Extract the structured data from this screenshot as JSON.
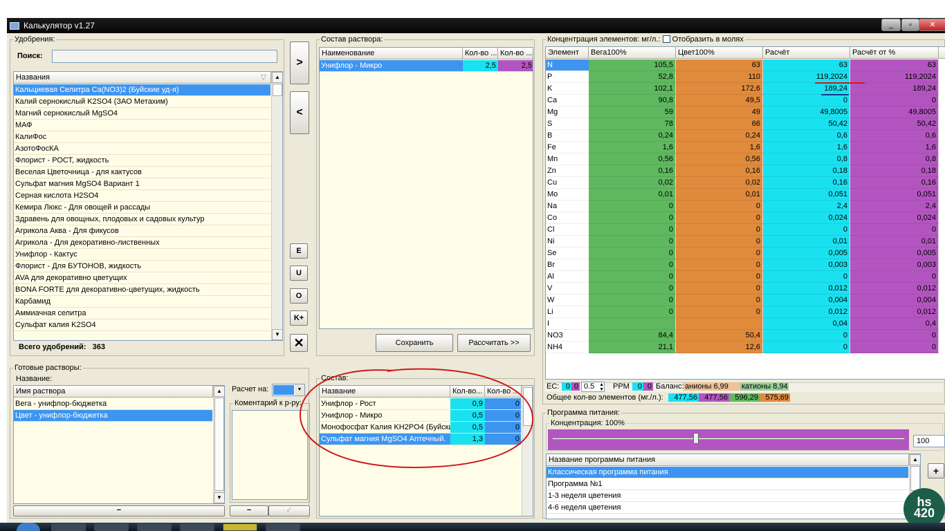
{
  "window": {
    "title": "Калькулятор v1.27"
  },
  "fertilizers": {
    "group_label": "Удобрения:",
    "search_label": "Поиск:",
    "search_value": "",
    "column_name": "Названия",
    "items": [
      "Кальциевая Селитра Ca(NO3)2 (Буйские уд-я)",
      "Калий  сернокислый  K2SO4 (ЗАО Метахим)",
      "Магний сернокислый MgSO4",
      "МАФ",
      "КалиФос",
      "АзотоФосКА",
      "Флорист - РОСТ, жидкость",
      "Веселая Цветочница - для кактусов",
      "Сульфат магния MgSO4 Вариант 1",
      "Серная кислота H2SO4",
      "Кемира Люкс - Для овощей и рассады",
      "Здравень для овощных, плодовых и садовых культур",
      "Агрикола Аква - Для фикусов",
      "Агрикола - Для декоративно-лиственных",
      "Унифлор - Кактус",
      "Флорист - Для БУТОНОВ, жидкость",
      "AVA для декоративно цветущих",
      "BONA FORTE для декоративно-цветущих, жидкость",
      "Карбамид",
      "Аммиачная селитра",
      "Сульфат калия K2SO4"
    ],
    "total_label": "Всего удобрений:",
    "total_value": "363"
  },
  "side_buttons": {
    "add": ">",
    "remove": "<",
    "e": "E",
    "u": "U",
    "o": "O",
    "kplus": "K+",
    "delete": "✕"
  },
  "solution": {
    "group_label": "Состав раствора:",
    "col_name": "Наименование",
    "col_qty1": "Кол-во ...",
    "col_qty2": "Кол-во ...",
    "rows": [
      {
        "name": "Унифлор - Микро",
        "q1": "2,5",
        "q2": "2,5"
      }
    ],
    "save_label": "Сохранить",
    "calc_label": "Рассчитать >>"
  },
  "ready": {
    "group_label": "Готовые растворы:",
    "name_label": "Название:",
    "col_name": "Имя раствора",
    "rows": [
      "Вега - унифлор-бюджетка",
      "Цвет - унифлор-бюджетка"
    ],
    "minus": "−",
    "calc_for_label": "Расчет на:",
    "comment_label": "Коментарий к р-ру:",
    "comment_minus": "−",
    "comment_check": "✓"
  },
  "composition": {
    "group_label": "Состав:",
    "col_name": "Название",
    "col_q1": "Кол-во...",
    "col_q2": "Кол-во ...",
    "rows": [
      {
        "name": "Унифлор - Рост",
        "q1": "0,9",
        "q2": "0"
      },
      {
        "name": "Унифлор - Микро",
        "q1": "0,5",
        "q2": "0"
      },
      {
        "name": "Монофосфат Калия KH2PO4 (Буйски",
        "q1": "0,5",
        "q2": "0"
      },
      {
        "name": "Сульфат магния MgSO4 Аптечный.",
        "q1": "1,3",
        "q2": "0"
      }
    ]
  },
  "concentration": {
    "group_label": "Концентрация элементов: мг/л.:",
    "moles_label": "Отобразить в молях",
    "headers": [
      "Элемент",
      "Вега100%",
      "Цвет100%",
      "Расчёт",
      "Расчёт от %"
    ],
    "rows": [
      [
        "N",
        "105,5",
        "63",
        "63",
        "63"
      ],
      [
        "P",
        "52,8",
        "110",
        "119,2024",
        "119,2024"
      ],
      [
        "K",
        "102,1",
        "172,6",
        "189,24",
        "189,24"
      ],
      [
        "Ca",
        "90,8",
        "49,5",
        "0",
        "0"
      ],
      [
        "Mg",
        "59",
        "49",
        "49,8005",
        "49,8005"
      ],
      [
        "S",
        "78",
        "66",
        "50,42",
        "50,42"
      ],
      [
        "B",
        "0,24",
        "0,24",
        "0,6",
        "0,6"
      ],
      [
        "Fe",
        "1,6",
        "1,6",
        "1,6",
        "1,6"
      ],
      [
        "Mn",
        "0,56",
        "0,56",
        "0,8",
        "0,8"
      ],
      [
        "Zn",
        "0,16",
        "0,16",
        "0,18",
        "0,18"
      ],
      [
        "Cu",
        "0,02",
        "0,02",
        "0,16",
        "0,16"
      ],
      [
        "Mo",
        "0,01",
        "0,01",
        "0,051",
        "0,051"
      ],
      [
        "Na",
        "0",
        "0",
        "2,4",
        "2,4"
      ],
      [
        "Co",
        "0",
        "0",
        "0,024",
        "0,024"
      ],
      [
        "Cl",
        "0",
        "0",
        "0",
        "0"
      ],
      [
        "Ni",
        "0",
        "0",
        "0,01",
        "0,01"
      ],
      [
        "Se",
        "0",
        "0",
        "0,005",
        "0,005"
      ],
      [
        "Br",
        "0",
        "0",
        "0,003",
        "0,003"
      ],
      [
        "Al",
        "0",
        "0",
        "0",
        "0"
      ],
      [
        "V",
        "0",
        "0",
        "0,012",
        "0,012"
      ],
      [
        "W",
        "0",
        "0",
        "0,004",
        "0,004"
      ],
      [
        "Li",
        "0",
        "0",
        "0,012",
        "0,012"
      ],
      [
        "I",
        "",
        "",
        "0,04",
        "0,4"
      ],
      [
        "NO3",
        "84,4",
        "50,4",
        "0",
        "0"
      ],
      [
        "NH4",
        "21,1",
        "12,6",
        "0",
        "0"
      ]
    ],
    "colors": {
      "vega": "#5fb85f",
      "cvet": "#e08a3c",
      "calc": "#1ae1f0",
      "calcp": "#b355c0"
    }
  },
  "ec": {
    "ec_label": "EC:",
    "ec_a": "0",
    "ec_b": "0",
    "ec_spin": "0.5",
    "ppm_label": "PPM",
    "ppm_a": "0",
    "ppm_b": "0",
    "balance_label": "Баланс:",
    "anions": "анионы 6,99",
    "cations": "катионы 8,94",
    "total_label": "Общее кол-во элементов (мг./л.):",
    "totals": [
      "477,56",
      "477,56",
      "596,29",
      "575,69"
    ]
  },
  "program": {
    "group_label": "Программа питания:",
    "conc_label": "Концентрация: 100%",
    "slider_value": "100",
    "slider_fraction": 0.4,
    "col_name": "Название программы питания",
    "rows": [
      "Классическая программа питания",
      "Программа №1",
      "1-3 неделя цветения",
      "4-6 неделя цветения"
    ],
    "plus": "+"
  },
  "watermark": {
    "text": "hs\n420"
  }
}
